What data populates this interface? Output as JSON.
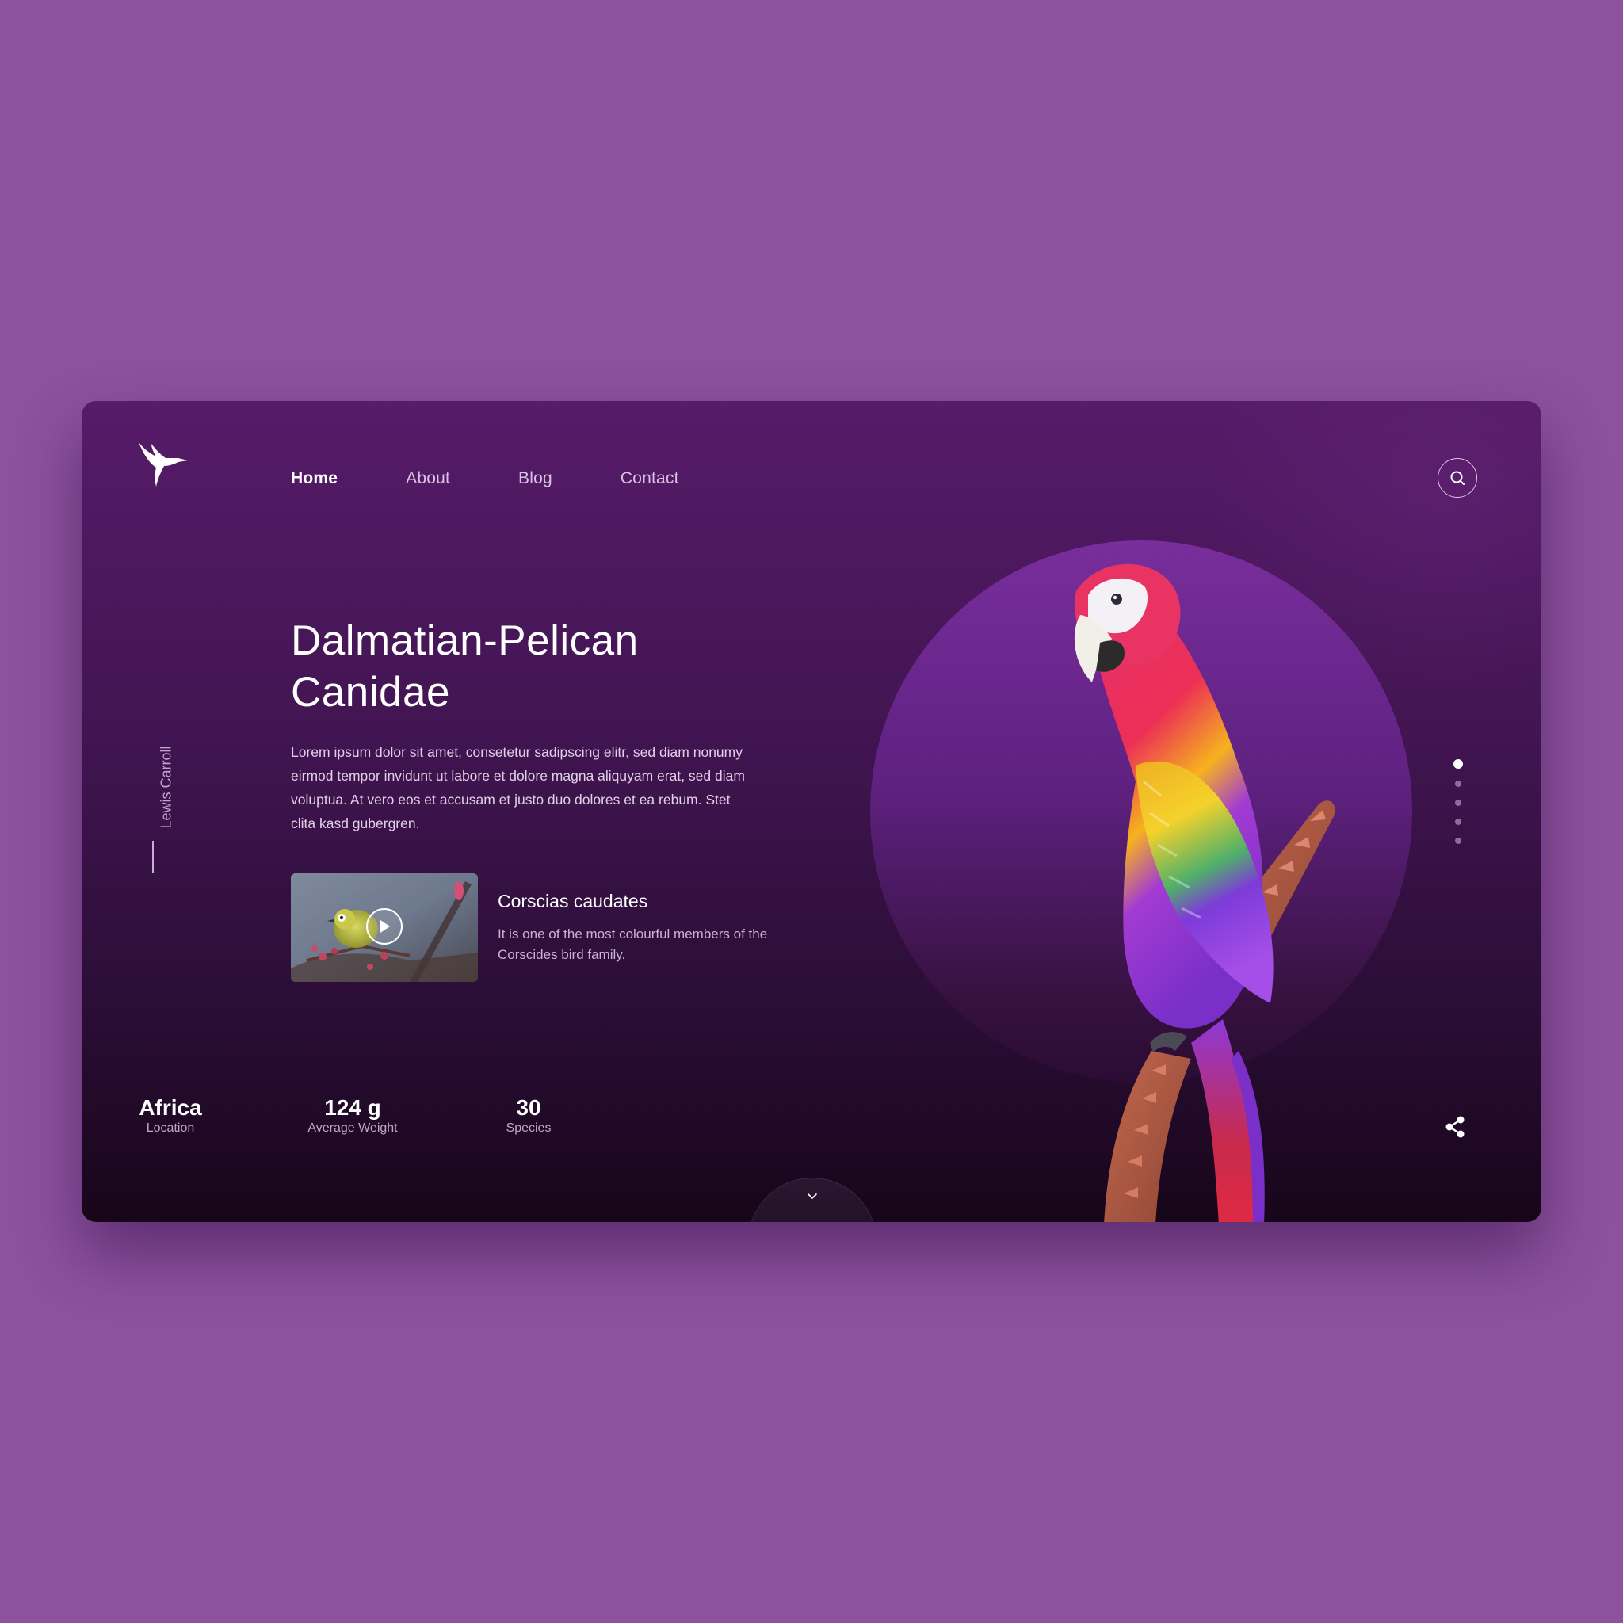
{
  "nav": {
    "items": [
      {
        "label": "Home",
        "active": true
      },
      {
        "label": "About",
        "active": false
      },
      {
        "label": "Blog",
        "active": false
      },
      {
        "label": "Contact",
        "active": false
      }
    ]
  },
  "icons": {
    "logo": "hummingbird-logo-icon",
    "search": "search-icon",
    "play": "play-icon",
    "scroll": "chevron-down-icon",
    "share": "share-icon"
  },
  "author": "Lewis Carroll",
  "hero": {
    "title_line1": "Dalmatian-Pelican",
    "title_line2": "Canidae",
    "description": "Lorem ipsum dolor sit amet, consetetur sadipscing elitr, sed diam nonumy eirmod tempor invidunt ut labore et dolore magna aliquyam erat, sed diam voluptua. At vero eos et accusam et justo duo dolores et ea rebum. Stet clita kasd gubergren."
  },
  "video": {
    "title": "Corscias caudates",
    "description": "It is one of the most colourful members of the Corscides bird family."
  },
  "stats": [
    {
      "value": "Africa",
      "label": "Location"
    },
    {
      "value": "124 g",
      "label": "Average Weight"
    },
    {
      "value": "30",
      "label": "Species"
    }
  ],
  "slider": {
    "count": 5,
    "active_index": 0
  },
  "colors": {
    "page_bg": "#8c529d",
    "card_top": "#561b69",
    "card_bottom": "#170519",
    "circle": "#782e9c",
    "text": "#ffffff",
    "muted_text": "#cbb1d6"
  }
}
